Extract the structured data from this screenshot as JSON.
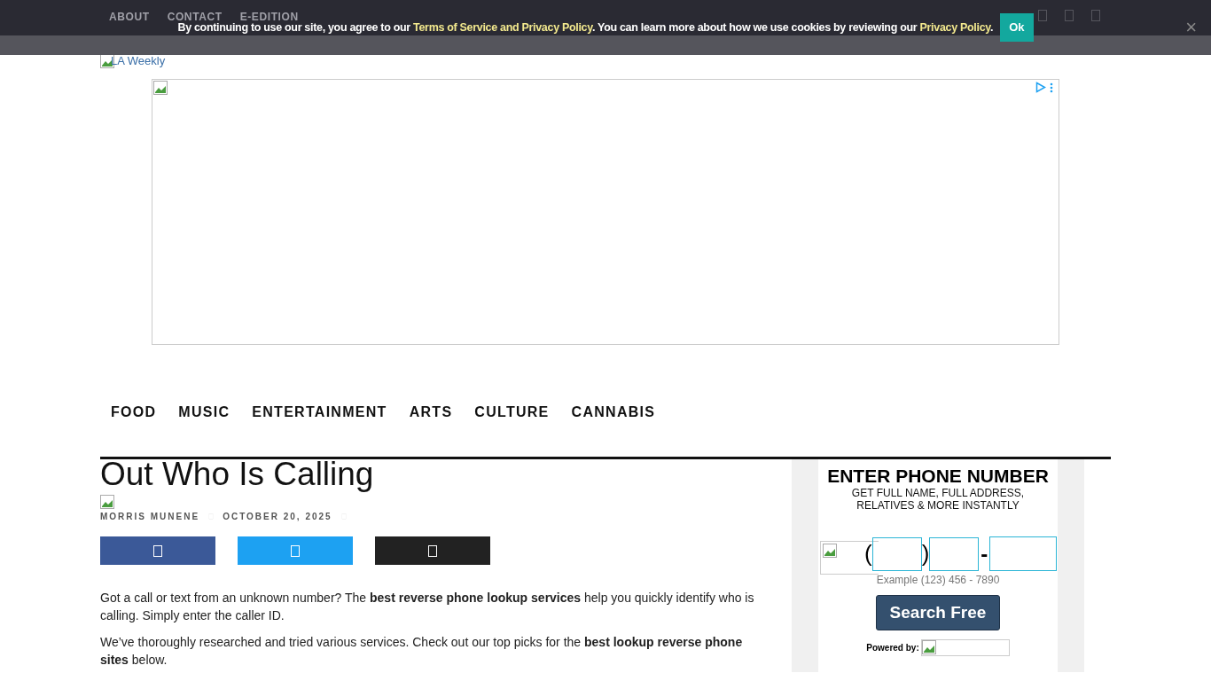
{
  "top_nav": {
    "items": [
      "ABOUT",
      "CONTACT",
      "E-EDITION"
    ]
  },
  "cookie_banner": {
    "parts": [
      {
        "text": "By continuing to use our site, you agree to our ",
        "link": false
      },
      {
        "text": "Terms of Service and Privacy Policy",
        "link": true
      },
      {
        "text": ". You can learn more about how we use cookies by reviewing our ",
        "link": false
      },
      {
        "text": "Privacy Policy",
        "link": true
      },
      {
        "text": ".",
        "link": false
      }
    ],
    "ok_button": "Ok",
    "close": "×"
  },
  "logo": {
    "alt": "LA Weekly"
  },
  "categories": [
    "FOOD",
    "MUSIC",
    "ENTERTAINMENT",
    "ARTS",
    "CULTURE",
    "CANNABIS"
  ],
  "article": {
    "title": "Out Who Is Calling",
    "author": "MORRIS MUNENE",
    "date": "OCTOBER 20, 2025",
    "share_buttons": [
      {
        "kind": "facebook"
      },
      {
        "kind": "twitter"
      },
      {
        "kind": "email"
      }
    ],
    "paragraphs": [
      "Got a call or text from an unknown number? The **best reverse phone lookup services** help you quickly identify who is calling. Simply enter the caller ID.",
      "We’ve thoroughly researched and tried various services. Check out our top picks for the **best lookup reverse phone sites** below."
    ]
  },
  "widget": {
    "heading": "ENTER PHONE NUMBER",
    "subheading": [
      "GET FULL NAME, FULL ADDRESS,",
      "RELATIVES & MORE INSTANTLY"
    ],
    "open_paren": "(",
    "close_paren": ")",
    "dash": "-",
    "example": "Example (123) 456 - 7890",
    "button": "Search Free",
    "powered_by": "Powered by:"
  }
}
